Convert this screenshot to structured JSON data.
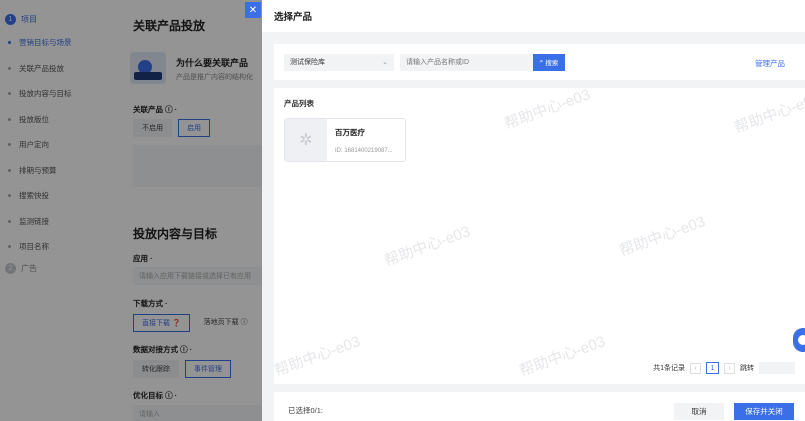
{
  "sidebar": {
    "step1": {
      "num": "1",
      "label": "项目"
    },
    "items": [
      {
        "label": "营销目标与场景"
      },
      {
        "label": "关联产品投放"
      },
      {
        "label": "投放内容与目标"
      },
      {
        "label": "投放版位"
      },
      {
        "label": "用户定向"
      },
      {
        "label": "排期与预算"
      },
      {
        "label": "搜索快投"
      },
      {
        "label": "监测链接"
      },
      {
        "label": "项目名称"
      }
    ],
    "step2": {
      "num": "2",
      "label": "广告"
    }
  },
  "main": {
    "section1_title": "关联产品投放",
    "banner_title": "为什么要关联产品",
    "banner_sub": "产品是推广内容的结构化",
    "product_field_label": "关联产品 ⓘ ·",
    "opt_disable": "不启用",
    "opt_enable": "启用",
    "section2_title": "投放内容与目标",
    "app_label": "应用 ·",
    "app_placeholder": "请输入应用下载链接或选择已有应用",
    "download_label": "下载方式 ·",
    "download_direct": "直接下载 ❓",
    "download_landing": "落地页下载 ⓘ",
    "data_label": "数据对接方式 ⓘ ·",
    "data_opt1": "转化跟踪",
    "data_opt2": "事件管理",
    "opt_goal_label": "优化目标 ⓘ ·",
    "opt_goal_placeholder": "请输入"
  },
  "close_glyph": "✕",
  "drawer": {
    "title": "选择产品",
    "library_select": "测试保险库",
    "search_placeholder": "请输入产品名称或ID",
    "search_button": "搜索",
    "manage_link": "管理产品",
    "list_title": "产品列表",
    "products": [
      {
        "name": "百万医疗",
        "id": "ID: 1681400219087..."
      }
    ],
    "pager": {
      "total": "共1条记录",
      "current": "1",
      "jump_label": "跳转"
    },
    "footer": {
      "selected": "已选择0/1:",
      "cancel": "取消",
      "save": "保存并关闭"
    }
  },
  "watermark_text": "帮助中心-e03",
  "colors": {
    "primary": "#3a6fe8"
  }
}
